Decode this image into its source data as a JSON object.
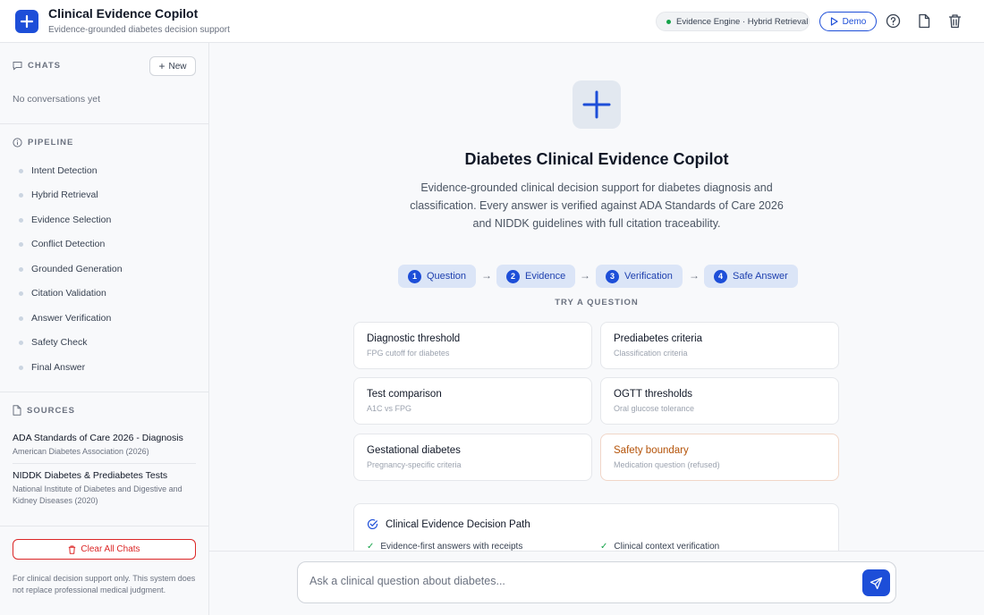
{
  "header": {
    "title": "Clinical Evidence Copilot",
    "subtitle": "Evidence-grounded diabetes decision support",
    "engine_status": "Evidence Engine · Hybrid Retrieval",
    "demo_label": "Demo"
  },
  "sidebar": {
    "chats_heading": "CHATS",
    "new_label": "New",
    "empty_text": "No conversations yet",
    "pipeline_heading": "PIPELINE",
    "pipeline": [
      "Intent Detection",
      "Hybrid Retrieval",
      "Evidence Selection",
      "Conflict Detection",
      "Grounded Generation",
      "Citation Validation",
      "Answer Verification",
      "Safety Check",
      "Final Answer"
    ],
    "sources_heading": "SOURCES",
    "sources": [
      {
        "title": "ADA Standards of Care 2026 - Diagnosis",
        "org": "American Diabetes Association (2026)"
      },
      {
        "title": "NIDDK Diabetes & Prediabetes Tests",
        "org": "National Institute of Diabetes and Digestive and Kidney Diseases (2020)"
      }
    ],
    "clear_label": "Clear All Chats",
    "disclaimer": "For clinical decision support only. This system does not replace professional medical judgment."
  },
  "main": {
    "title": "Diabetes Clinical Evidence Copilot",
    "description": "Evidence-grounded clinical decision support for diabetes diagnosis and classification. Every answer is verified against ADA Standards of Care 2026 and NIDDK guidelines with full citation traceability.",
    "steps": [
      {
        "num": "1",
        "label": "Question"
      },
      {
        "num": "2",
        "label": "Evidence"
      },
      {
        "num": "3",
        "label": "Verification"
      },
      {
        "num": "4",
        "label": "Safe Answer"
      }
    ],
    "arrow": "→",
    "try_label": "TRY A QUESTION",
    "questions": [
      {
        "title": "Diagnostic threshold",
        "sub": "FPG cutoff for diabetes"
      },
      {
        "title": "Prediabetes criteria",
        "sub": "Classification criteria"
      },
      {
        "title": "Test comparison",
        "sub": "A1C vs FPG"
      },
      {
        "title": "OGTT thresholds",
        "sub": "Oral glucose tolerance"
      },
      {
        "title": "Gestational diabetes",
        "sub": "Pregnancy-specific criteria"
      },
      {
        "title": "Safety boundary",
        "sub": "Medication question (refused)"
      }
    ],
    "path_title": "Clinical Evidence Decision Path",
    "path_items": [
      "Evidence-first answers with receipts",
      "Clinical context verification"
    ]
  },
  "composer": {
    "placeholder": "Ask a clinical question about diabetes..."
  },
  "colors": {
    "accent": "#1d4ed8",
    "danger": "#dc2626",
    "warning": "#b45309",
    "success": "#16a34a"
  }
}
